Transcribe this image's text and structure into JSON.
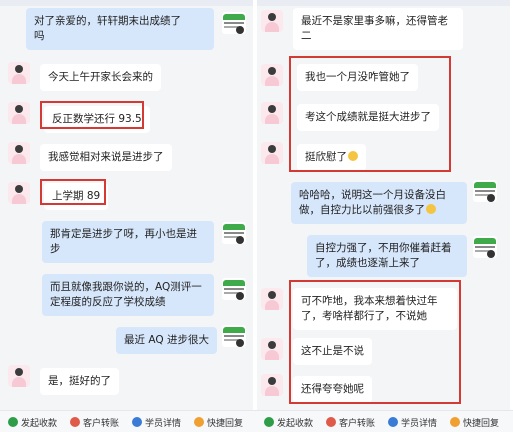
{
  "left": {
    "header": "",
    "messages": [
      {
        "side": "out",
        "text": "对了亲爱的，轩轩期末出成绩了\n吗"
      },
      {
        "side": "in",
        "text": "今天上午开家长会来的"
      },
      {
        "side": "in",
        "text": "反正数学还行 93.5"
      },
      {
        "side": "in",
        "text": "我感觉相对来说是进步了"
      },
      {
        "side": "in",
        "text": "上学期 89"
      },
      {
        "side": "out",
        "text": "那肯定是进步了呀，再小也是进\n步"
      },
      {
        "side": "out",
        "text": "而且就像我跟你说的，AQ测评一\n定程度的反应了学校成绩"
      },
      {
        "side": "out",
        "text": "最近 AQ 进步很大"
      },
      {
        "side": "in",
        "text": "是，挺好的了"
      }
    ]
  },
  "right": {
    "header": "",
    "messages": [
      {
        "side": "in",
        "text": "最近不是家里事多嘛，还得管老\n二"
      },
      {
        "side": "in",
        "text": "我也一个月没咋管她了"
      },
      {
        "side": "in",
        "text": "考这个成绩就是挺大进步了"
      },
      {
        "side": "in",
        "text": "挺欣慰了"
      },
      {
        "side": "out",
        "text": "哈哈哈，说明这一个月设备没白\n做，自控力比以前强很多了"
      },
      {
        "side": "out",
        "text": "自控力强了，不用你催着赶着\n了，成绩也逐渐上来了"
      },
      {
        "side": "in",
        "text": "可不咋地，我本来想着快过年\n了，考啥样都行了，不说她"
      },
      {
        "side": "in",
        "text": "这不止是不说"
      },
      {
        "side": "in",
        "text": "还得夸夸她呢"
      }
    ]
  },
  "quick_actions": [
    {
      "label": "发起收款",
      "color": "#2e9d4a",
      "icon": "money-icon"
    },
    {
      "label": "客户转账",
      "color": "#e05a4a",
      "icon": "transfer-icon"
    },
    {
      "label": "学员详情",
      "color": "#3a7bd5",
      "icon": "user-icon"
    },
    {
      "label": "快捷回复",
      "color": "#f0a030",
      "icon": "reply-icon"
    },
    {
      "label": "发起收款",
      "color": "#2e9d4a",
      "icon": "money-icon"
    },
    {
      "label": "客户转账",
      "color": "#e05a4a",
      "icon": "transfer-icon"
    },
    {
      "label": "学员详情",
      "color": "#3a7bd5",
      "icon": "user-icon"
    },
    {
      "label": "快捷回复",
      "color": "#f0a030",
      "icon": "reply-icon"
    }
  ]
}
